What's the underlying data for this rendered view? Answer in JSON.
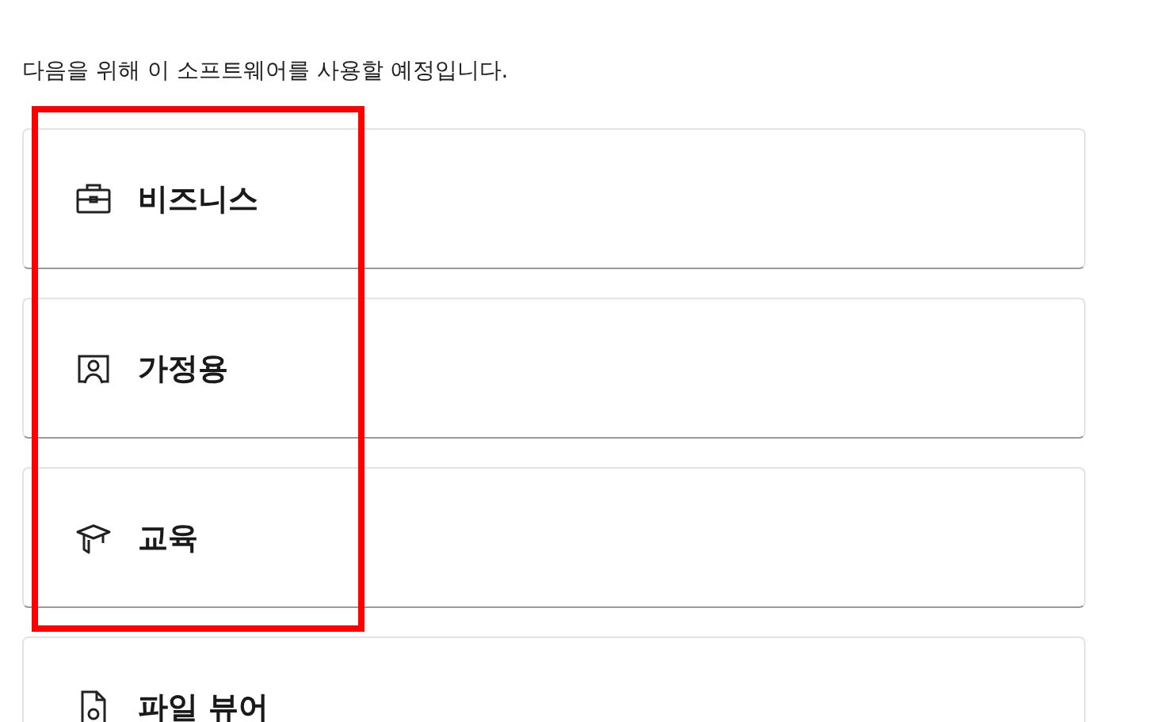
{
  "prompt": "다음을 위해 이 소프트웨어를 사용할 예정입니다.",
  "options": [
    {
      "kind": "briefcase",
      "label": "비즈니스"
    },
    {
      "kind": "person",
      "label": "가정용"
    },
    {
      "kind": "graduation",
      "label": "교육"
    },
    {
      "kind": "document",
      "label": "파일 뷰어"
    }
  ],
  "highlight": {
    "on": true
  }
}
